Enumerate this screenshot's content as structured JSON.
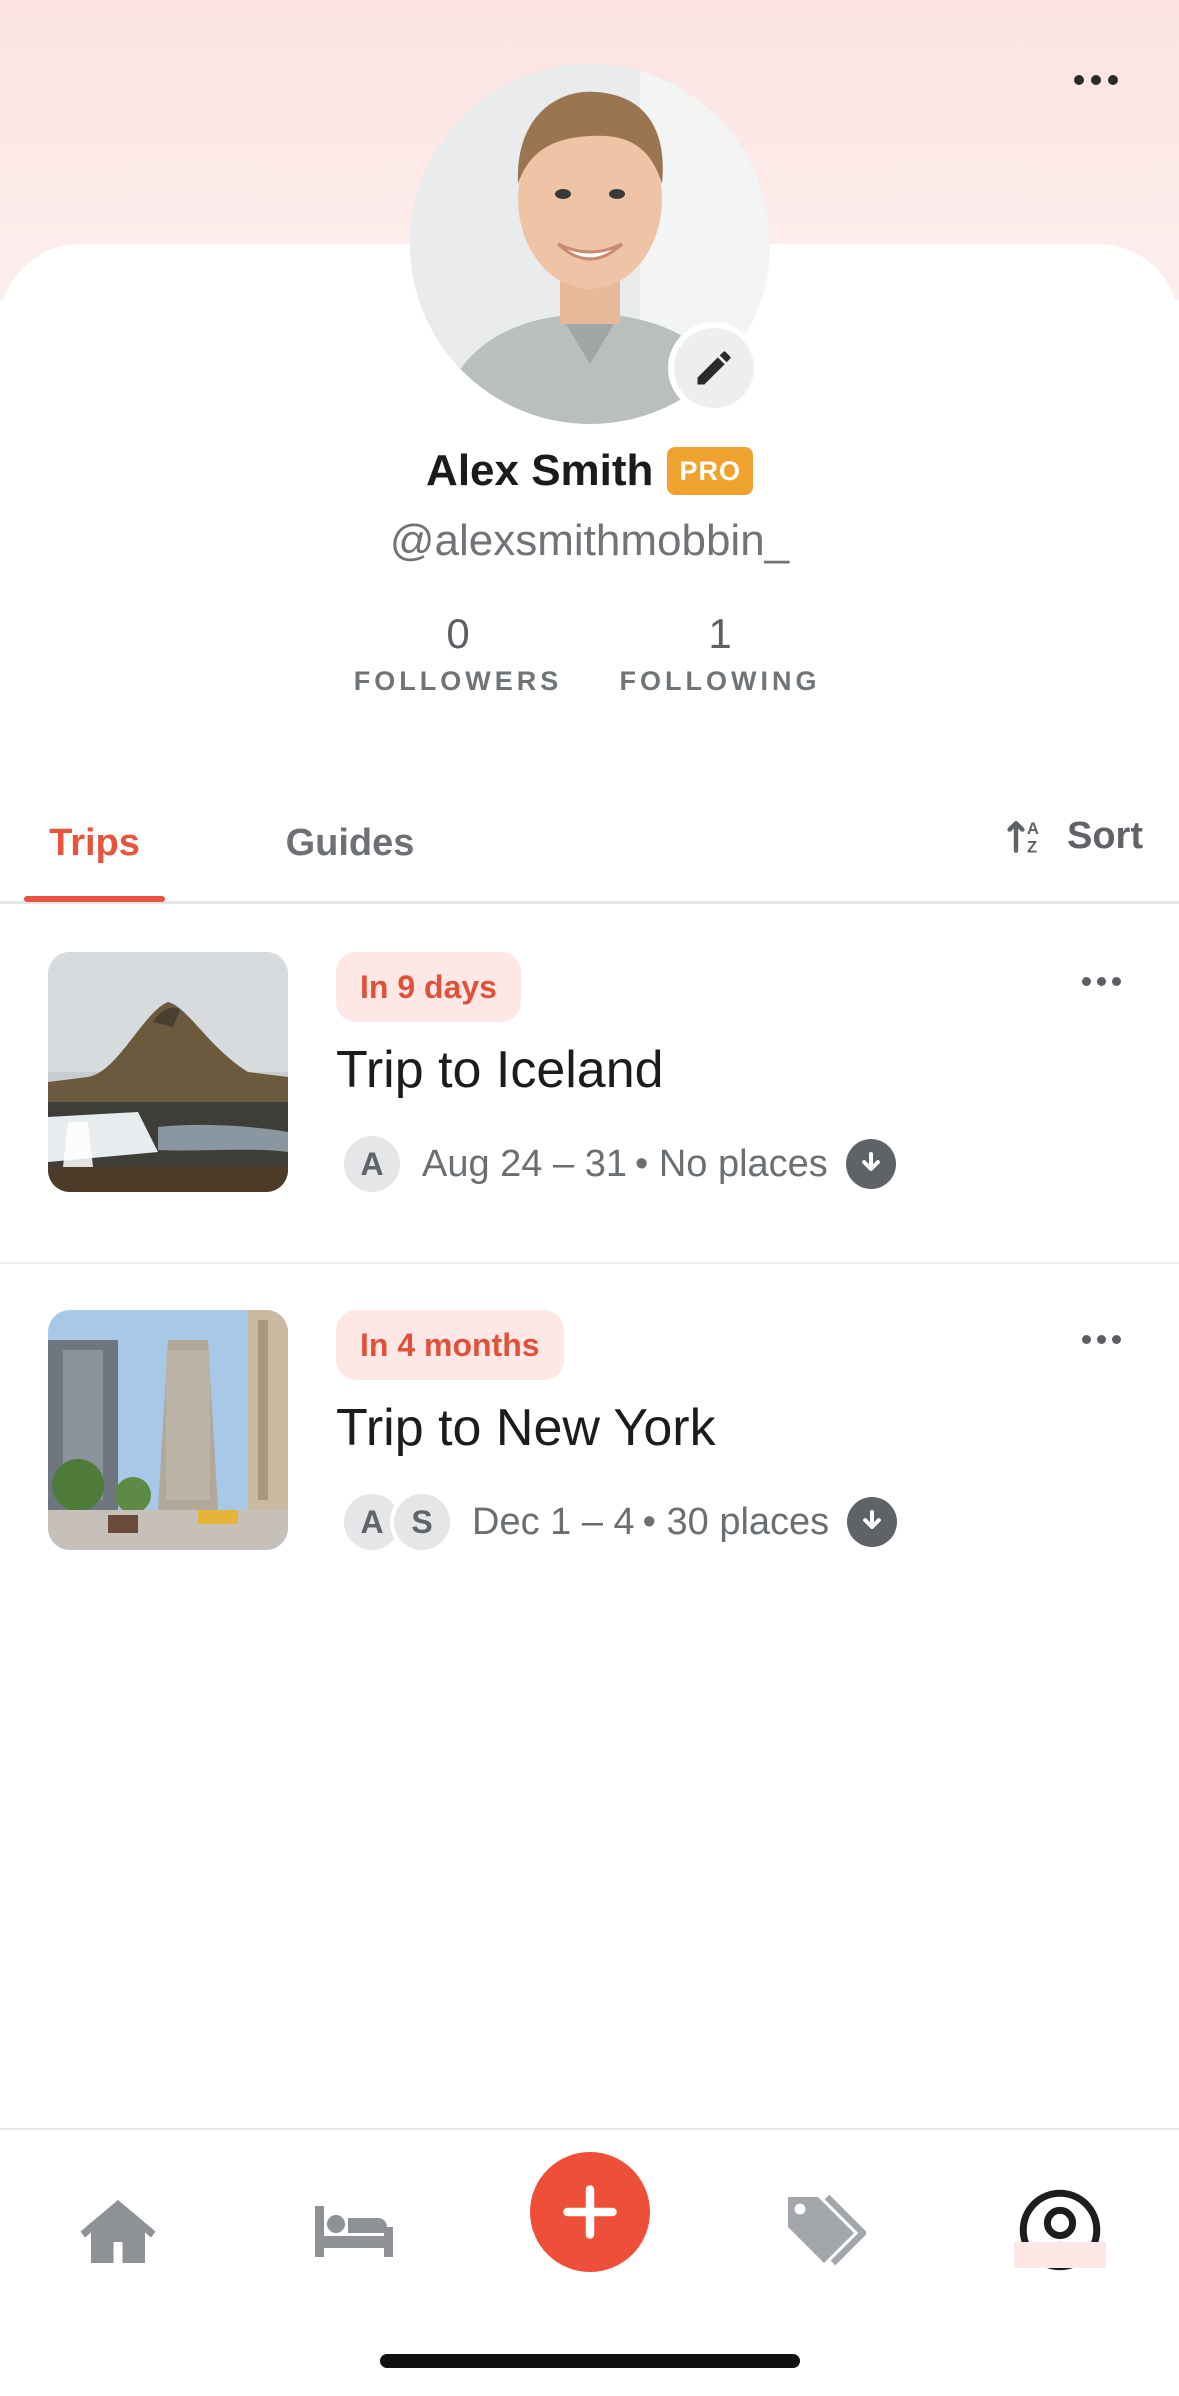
{
  "colors": {
    "accent": "#e8533c",
    "pro_badge": "#f0a22e",
    "header_bg": "#fbe4e2"
  },
  "profile": {
    "name": "Alex Smith",
    "pro_label": "PRO",
    "handle": "@alexsmithmobbin_",
    "followers_count": "0",
    "followers_label": "FOLLOWERS",
    "following_count": "1",
    "following_label": "FOLLOWING"
  },
  "tabs": {
    "items": [
      {
        "label": "Trips",
        "active": true
      },
      {
        "label": "Guides",
        "active": false
      }
    ],
    "sort_label": "Sort"
  },
  "trips": [
    {
      "badge": "In 9 days",
      "title": "Trip to Iceland",
      "avatars": [
        "A"
      ],
      "dates": "Aug 24 –  31",
      "places": "• No places"
    },
    {
      "badge": "In 4 months",
      "title": "Trip to New York",
      "avatars": [
        "A",
        "S"
      ],
      "dates": "Dec 1 –  4",
      "places": "• 30 places"
    }
  ],
  "bottom_nav": {
    "items": [
      {
        "icon": "home-icon"
      },
      {
        "icon": "bed-icon"
      },
      {
        "icon": "plus-icon"
      },
      {
        "icon": "tags-icon"
      },
      {
        "icon": "profile-icon",
        "active": true
      }
    ]
  }
}
